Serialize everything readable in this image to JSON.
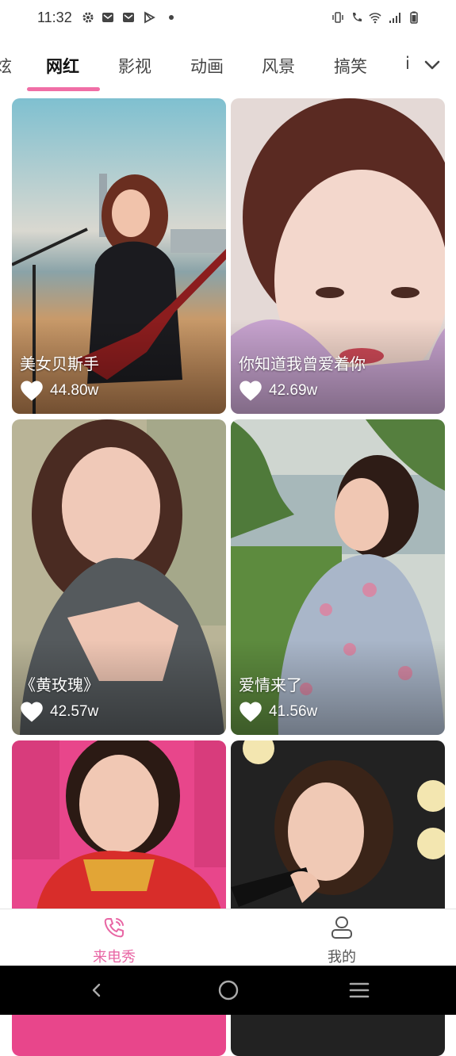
{
  "status": {
    "time": "11:32"
  },
  "tabs": [
    {
      "label": "炫"
    },
    {
      "label": "网红"
    },
    {
      "label": "影视"
    },
    {
      "label": "动画"
    },
    {
      "label": "风景"
    },
    {
      "label": "搞笑"
    },
    {
      "label": "i"
    }
  ],
  "active_tab": "网红",
  "cards": [
    {
      "title": "美女贝斯手",
      "likes": "44.80w"
    },
    {
      "title": "你知道我曾爱着你",
      "likes": "42.69w"
    },
    {
      "title": "《黄玫瑰》",
      "likes": "42.57w"
    },
    {
      "title": "爱情来了",
      "likes": "41.56w"
    },
    {
      "title": "",
      "likes": ""
    },
    {
      "title": "",
      "likes": ""
    }
  ],
  "bottom_nav": [
    {
      "label": "来电秀",
      "icon": "phone-icon",
      "active": true
    },
    {
      "label": "我的",
      "icon": "user-icon",
      "active": false
    }
  ],
  "colors": {
    "accent": "#f06ea6",
    "nav_inactive": "#555555",
    "system_nav": "#000000"
  }
}
